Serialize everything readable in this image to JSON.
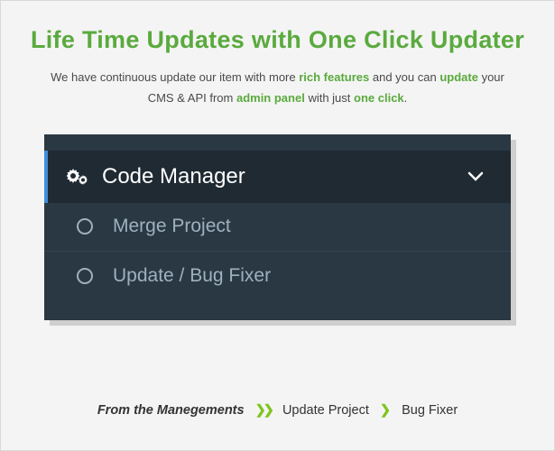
{
  "title": "Life Time Updates with One Click Updater",
  "subtitle": {
    "t1": "We have continuous update our item with more ",
    "h1": "rich features",
    "t2": " and you can ",
    "h2": "update",
    "t3": " your CMS & API from ",
    "h3": "admin panel",
    "t4": " with just ",
    "h4": "one click",
    "t5": "."
  },
  "panel": {
    "header": "Code Manager",
    "items": [
      "Merge Project",
      "Update / Bug Fixer"
    ]
  },
  "breadcrumb": {
    "from": "From the Manegements",
    "step1": "Update Project",
    "step2": "Bug Fixer"
  }
}
